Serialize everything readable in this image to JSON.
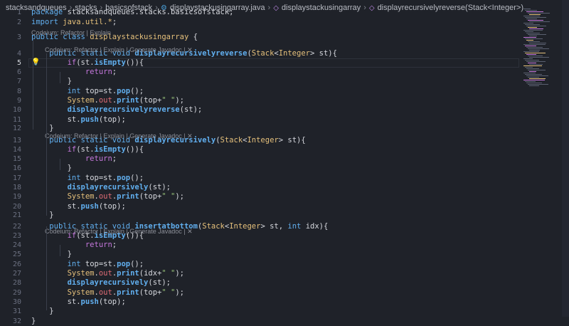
{
  "breadcrumb": {
    "items": [
      "stacksandqueues",
      "stacks",
      "basicsofstack",
      "displaystackusingarray.java",
      "displaystackusingarray",
      "displayrecursivelyreverse(Stack<Integer>)"
    ]
  },
  "codelens": {
    "short": "Codeium: Refactor | Explain",
    "full": "Codeium: Refactor | Explain | Generate Javadoc | ✕"
  },
  "lines": [
    {
      "n": "1",
      "code": [
        [
          "kwb",
          "package "
        ],
        [
          "pkg",
          "stacksandqueues.stacks.basicsofstack;"
        ]
      ]
    },
    {
      "n": "2",
      "code": [
        [
          "kwb",
          "import "
        ],
        [
          "ty",
          "java.util.*"
        ],
        [
          "pl",
          ";"
        ]
      ]
    },
    {
      "n": "3",
      "code": [
        [
          "kwb",
          "public class "
        ],
        [
          "ty",
          "displaystackusingarray"
        ],
        [
          "pl",
          " {"
        ]
      ]
    },
    {
      "n": "4",
      "code": [
        [
          "pl",
          "    "
        ],
        [
          "kwb",
          "public static void "
        ],
        [
          "fnb",
          "displayrecursivelyreverse"
        ],
        [
          "pl",
          "("
        ],
        [
          "ty",
          "Stack"
        ],
        [
          "pl",
          "<"
        ],
        [
          "ty",
          "Integer"
        ],
        [
          "pl",
          "> st){"
        ]
      ]
    },
    {
      "n": "5",
      "code": [
        [
          "pl",
          "        "
        ],
        [
          "kw",
          "if"
        ],
        [
          "pl",
          "(st."
        ],
        [
          "fnb",
          "isEmpty"
        ],
        [
          "pl",
          "()){"
        ]
      ]
    },
    {
      "n": "6",
      "code": [
        [
          "pl",
          "            "
        ],
        [
          "kw",
          "return"
        ],
        [
          "pl",
          ";"
        ]
      ]
    },
    {
      "n": "7",
      "code": [
        [
          "pl",
          "        }"
        ]
      ]
    },
    {
      "n": "8",
      "code": [
        [
          "pl",
          "        "
        ],
        [
          "kwb",
          "int "
        ],
        [
          "pl",
          "top="
        ],
        [
          "pl",
          "st."
        ],
        [
          "fnb",
          "pop"
        ],
        [
          "pl",
          "();"
        ]
      ]
    },
    {
      "n": "9",
      "code": [
        [
          "pl",
          "        "
        ],
        [
          "ty",
          "System"
        ],
        [
          "pl",
          "."
        ],
        [
          "var",
          "out"
        ],
        [
          "pl",
          "."
        ],
        [
          "fnb",
          "print"
        ],
        [
          "pl",
          "(top+"
        ],
        [
          "str",
          "\" \""
        ],
        [
          "pl",
          ");"
        ]
      ]
    },
    {
      "n": "10",
      "code": [
        [
          "pl",
          "        "
        ],
        [
          "fnb",
          "displayrecursivelyreverse"
        ],
        [
          "pl",
          "(st);"
        ]
      ]
    },
    {
      "n": "11",
      "code": [
        [
          "pl",
          "        st."
        ],
        [
          "fnb",
          "push"
        ],
        [
          "pl",
          "(top);"
        ]
      ]
    },
    {
      "n": "12",
      "code": [
        [
          "pl",
          "    }"
        ]
      ]
    },
    {
      "n": "13",
      "code": [
        [
          "pl",
          "    "
        ],
        [
          "kwb",
          "public static void "
        ],
        [
          "fnb",
          "displayrecursively"
        ],
        [
          "pl",
          "("
        ],
        [
          "ty",
          "Stack"
        ],
        [
          "pl",
          "<"
        ],
        [
          "ty",
          "Integer"
        ],
        [
          "pl",
          "> st){"
        ]
      ]
    },
    {
      "n": "14",
      "code": [
        [
          "pl",
          "        "
        ],
        [
          "kw",
          "if"
        ],
        [
          "pl",
          "(st."
        ],
        [
          "fnb",
          "isEmpty"
        ],
        [
          "pl",
          "()){"
        ]
      ]
    },
    {
      "n": "15",
      "code": [
        [
          "pl",
          "            "
        ],
        [
          "kw",
          "return"
        ],
        [
          "pl",
          ";"
        ]
      ]
    },
    {
      "n": "16",
      "code": [
        [
          "pl",
          "        }"
        ]
      ]
    },
    {
      "n": "17",
      "code": [
        [
          "pl",
          "        "
        ],
        [
          "kwb",
          "int "
        ],
        [
          "pl",
          "top=st."
        ],
        [
          "fnb",
          "pop"
        ],
        [
          "pl",
          "();"
        ]
      ]
    },
    {
      "n": "18",
      "code": [
        [
          "pl",
          "        "
        ],
        [
          "fnb",
          "displayrecursively"
        ],
        [
          "pl",
          "(st);"
        ]
      ]
    },
    {
      "n": "19",
      "code": [
        [
          "pl",
          "        "
        ],
        [
          "ty",
          "System"
        ],
        [
          "pl",
          "."
        ],
        [
          "var",
          "out"
        ],
        [
          "pl",
          "."
        ],
        [
          "fnb",
          "print"
        ],
        [
          "pl",
          "(top+"
        ],
        [
          "str",
          "\" \""
        ],
        [
          "pl",
          ");"
        ]
      ]
    },
    {
      "n": "20",
      "code": [
        [
          "pl",
          "        st."
        ],
        [
          "fnb",
          "push"
        ],
        [
          "pl",
          "(top);"
        ]
      ]
    },
    {
      "n": "21",
      "code": [
        [
          "pl",
          "    }"
        ]
      ]
    },
    {
      "n": "22",
      "code": [
        [
          "pl",
          "    "
        ],
        [
          "kwb",
          "public static void "
        ],
        [
          "fnb",
          "insertatbottom"
        ],
        [
          "pl",
          "("
        ],
        [
          "ty",
          "Stack"
        ],
        [
          "pl",
          "<"
        ],
        [
          "ty",
          "Integer"
        ],
        [
          "pl",
          "> st, "
        ],
        [
          "kwb",
          "int "
        ],
        [
          "pl",
          "idx){"
        ]
      ]
    },
    {
      "n": "23",
      "code": [
        [
          "pl",
          "        "
        ],
        [
          "kw",
          "if"
        ],
        [
          "pl",
          "(st."
        ],
        [
          "fnb",
          "isEmpty"
        ],
        [
          "pl",
          "()){"
        ]
      ]
    },
    {
      "n": "24",
      "code": [
        [
          "pl",
          "            "
        ],
        [
          "kw",
          "return"
        ],
        [
          "pl",
          ";"
        ]
      ]
    },
    {
      "n": "25",
      "code": [
        [
          "pl",
          "        }"
        ]
      ]
    },
    {
      "n": "26",
      "code": [
        [
          "pl",
          "        "
        ],
        [
          "kwb",
          "int "
        ],
        [
          "pl",
          "top=st."
        ],
        [
          "fnb",
          "pop"
        ],
        [
          "pl",
          "();"
        ]
      ]
    },
    {
      "n": "27",
      "code": [
        [
          "pl",
          "        "
        ],
        [
          "ty",
          "System"
        ],
        [
          "pl",
          "."
        ],
        [
          "var",
          "out"
        ],
        [
          "pl",
          "."
        ],
        [
          "fnb",
          "print"
        ],
        [
          "pl",
          "(idx+"
        ],
        [
          "str",
          "\" \""
        ],
        [
          "pl",
          ");"
        ]
      ]
    },
    {
      "n": "28",
      "code": [
        [
          "pl",
          "        "
        ],
        [
          "fnb",
          "displayrecursively"
        ],
        [
          "pl",
          "(st);"
        ]
      ]
    },
    {
      "n": "29",
      "code": [
        [
          "pl",
          "        "
        ],
        [
          "ty",
          "System"
        ],
        [
          "pl",
          "."
        ],
        [
          "var",
          "out"
        ],
        [
          "pl",
          "."
        ],
        [
          "fnb",
          "print"
        ],
        [
          "pl",
          "(top+"
        ],
        [
          "str",
          "\" \""
        ],
        [
          "pl",
          ");"
        ]
      ]
    },
    {
      "n": "30",
      "code": [
        [
          "pl",
          "        st."
        ],
        [
          "fnb",
          "push"
        ],
        [
          "pl",
          "(top);"
        ]
      ]
    },
    {
      "n": "31",
      "code": [
        [
          "pl",
          "    }"
        ]
      ]
    },
    {
      "n": "32",
      "code": [
        [
          "pl",
          "}"
        ]
      ]
    }
  ],
  "active_line": "5"
}
